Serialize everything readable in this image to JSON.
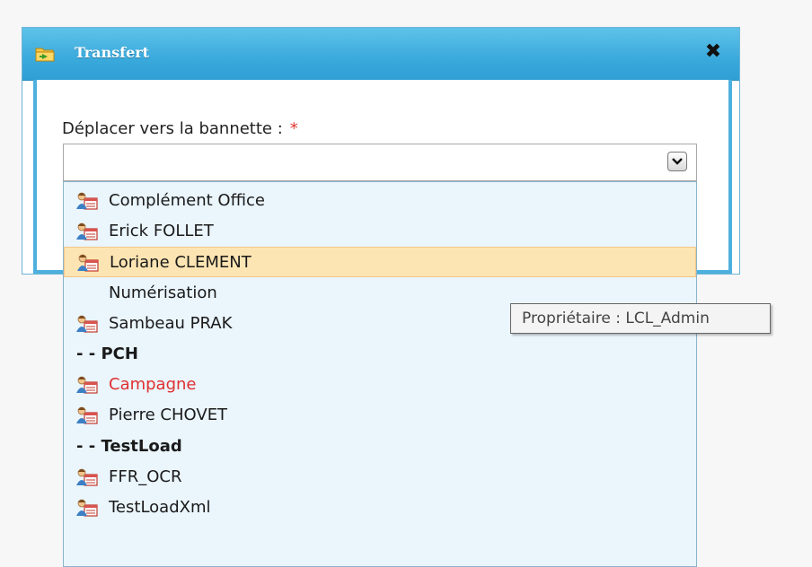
{
  "dialog": {
    "title": "Transfert",
    "title_icon": "folder-transfer-icon",
    "close_label": "✖",
    "field_label": "Déplacer vers la bannette :",
    "required_mark": "*"
  },
  "select": {
    "value": "",
    "arrow_icon": "chevron-down-icon"
  },
  "options": [
    {
      "label": "Complément Office",
      "icon": "user-card-icon",
      "kind": "user"
    },
    {
      "label": "Erick FOLLET",
      "icon": "user-card-icon",
      "kind": "user"
    },
    {
      "label": "Loriane CLEMENT",
      "icon": "user-card-icon",
      "kind": "user",
      "highlighted": true
    },
    {
      "label": "Numérisation",
      "kind": "plain"
    },
    {
      "label": "Sambeau PRAK",
      "icon": "user-card-icon",
      "kind": "user"
    },
    {
      "label": "- - PCH",
      "kind": "group"
    },
    {
      "label": "Campagne",
      "icon": "user-card-icon",
      "kind": "user",
      "color": "#e03030"
    },
    {
      "label": "Pierre CHOVET",
      "icon": "user-card-icon",
      "kind": "user"
    },
    {
      "label": "- - TestLoad",
      "kind": "group"
    },
    {
      "label": "FFR_OCR",
      "icon": "user-card-icon",
      "kind": "user"
    },
    {
      "label": "TestLoadXml",
      "icon": "user-card-icon",
      "kind": "user"
    }
  ],
  "tooltip": {
    "text": "Propriétaire : LCL_Admin"
  },
  "colors": {
    "titlebar": "#3aa9dc",
    "highlight": "#fde5b3",
    "dropdown_bg": "#eaf5fc",
    "required": "#e53935"
  }
}
